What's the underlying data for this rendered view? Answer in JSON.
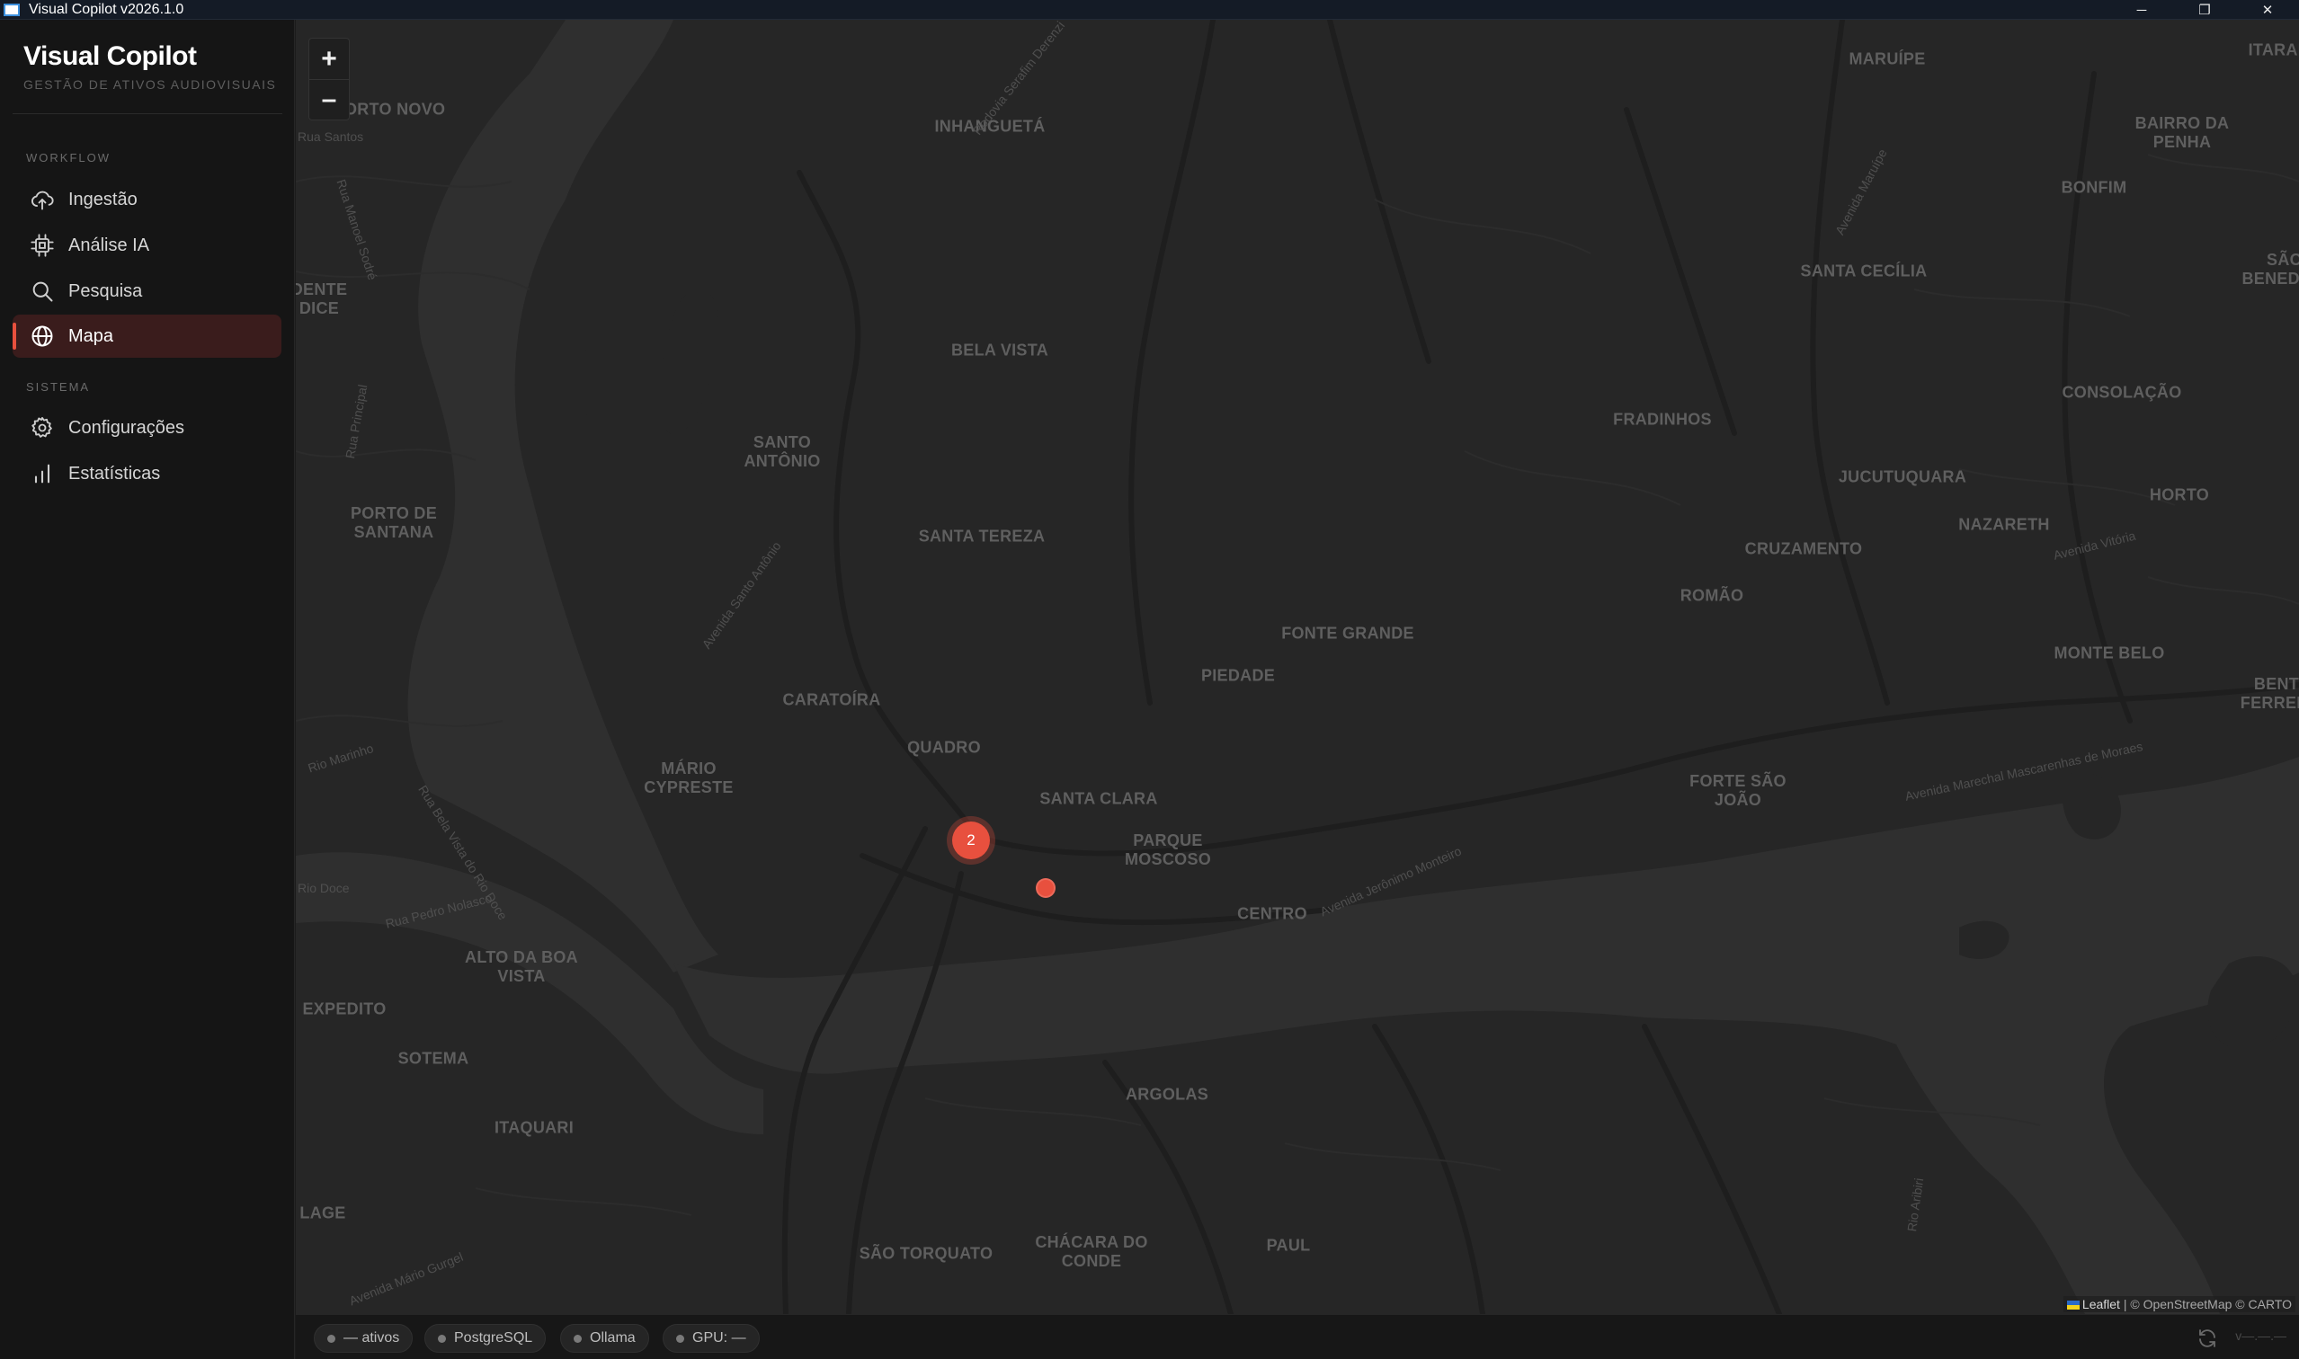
{
  "window": {
    "title": "Visual Copilot v2026.1.0",
    "minimize": "─",
    "maximize": "❐",
    "close": "✕"
  },
  "brand": {
    "name": "Visual Copilot",
    "tagline": "GESTÃO DE ATIVOS AUDIOVISUAIS"
  },
  "sidebar": {
    "sections": [
      {
        "label": "WORKFLOW",
        "items": [
          {
            "label": "Ingestão",
            "icon": "cloud-upload-icon",
            "active": false
          },
          {
            "label": "Análise IA",
            "icon": "cpu-chip-icon",
            "active": false
          },
          {
            "label": "Pesquisa",
            "icon": "search-icon",
            "active": false
          },
          {
            "label": "Mapa",
            "icon": "globe-icon",
            "active": true
          }
        ]
      },
      {
        "label": "SISTEMA",
        "items": [
          {
            "label": "Configurações",
            "icon": "gear-icon",
            "active": false
          },
          {
            "label": "Estatísticas",
            "icon": "bar-chart-icon",
            "active": false
          }
        ]
      }
    ]
  },
  "map": {
    "zoom_in": "+",
    "zoom_out": "–",
    "cluster_count": "2",
    "accent": "#e8503e",
    "attribution": {
      "leaflet": "Leaflet",
      "rest": "| © OpenStreetMap © CARTO"
    },
    "places": [
      "MARUÍPE",
      "ITARARÉ",
      "INHANGUETÁ",
      "BAIRRO DA\nPENHA",
      "BONFIM",
      "PORTO NOVO",
      "SANTA CECÍLIA",
      "SÃO BENEDITO",
      "BELA VISTA",
      "CONSOLAÇÃO",
      "FRADINHOS",
      "SANTO\nANTÔNIO",
      "JUCUTUQUARA",
      "HORTO",
      "NAZARETH",
      "PORTO DE\nSANTANA",
      "SANTA TEREZA",
      "CRUZAMENTO",
      "ROMÃO",
      "FONTE GRANDE",
      "MONTE BELO",
      "PIEDADE",
      "CARATOÍRA",
      "QUADRO",
      "BENTO\nFERREIRA",
      "MÁRIO\nCYPRESTE",
      "SANTA CLARA",
      "FORTE SÃO\nJOÃO",
      "PARQUE\nMOSCOSO",
      "CENTRO",
      "ALTO DA BOA\nVISTA",
      "EXPEDITO",
      "SOTEMA",
      "ARGOLAS",
      "ITAQUARI",
      "SÃO TORQUATO",
      "CHÁCARA DO\nCONDE",
      "PAUL",
      "DENTE\nDICE",
      "LAGE",
      "SÃO TORQUATO"
    ],
    "streets": [
      "Rodovia Serafim Derenzi",
      "Avenida Maruípe",
      "Avenida Vitória",
      "Avenida Santo Antônio",
      "Avenida Jerônimo Monteiro",
      "Avenida Marechal Mascarenhas de Moraes",
      "Rio Marinho",
      "Rio Doce",
      "Rua Pedro Nolasco",
      "Avenida Mário Gurgel",
      "Rua Bela Vista do Rio Doce",
      "Rio Aribiri",
      "Rua Santos",
      "Rua Manoel Sodré",
      "Rua Principal"
    ]
  },
  "statusbar": {
    "pills": [
      {
        "label": "— ativos"
      },
      {
        "label": "PostgreSQL"
      },
      {
        "label": "Ollama"
      },
      {
        "label": "GPU: —"
      }
    ],
    "version": "v—.—.—"
  }
}
